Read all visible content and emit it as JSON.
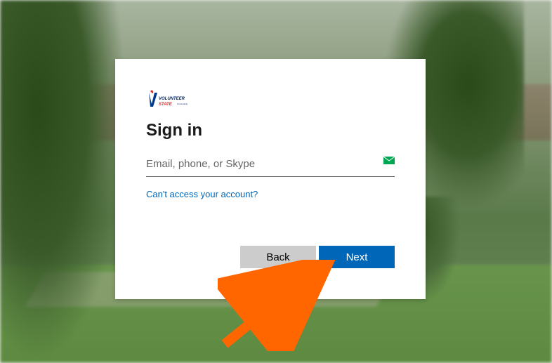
{
  "logo": {
    "text": "VOLUNTEER STATE",
    "subtext": "Community College"
  },
  "title": "Sign in",
  "input": {
    "placeholder": "Email, phone, or Skype",
    "value": ""
  },
  "help_link": "Can't access your account?",
  "buttons": {
    "back": "Back",
    "next": "Next"
  },
  "colors": {
    "primary": "#0067b8"
  },
  "annotation": {
    "arrow_points_to": "Next button"
  }
}
